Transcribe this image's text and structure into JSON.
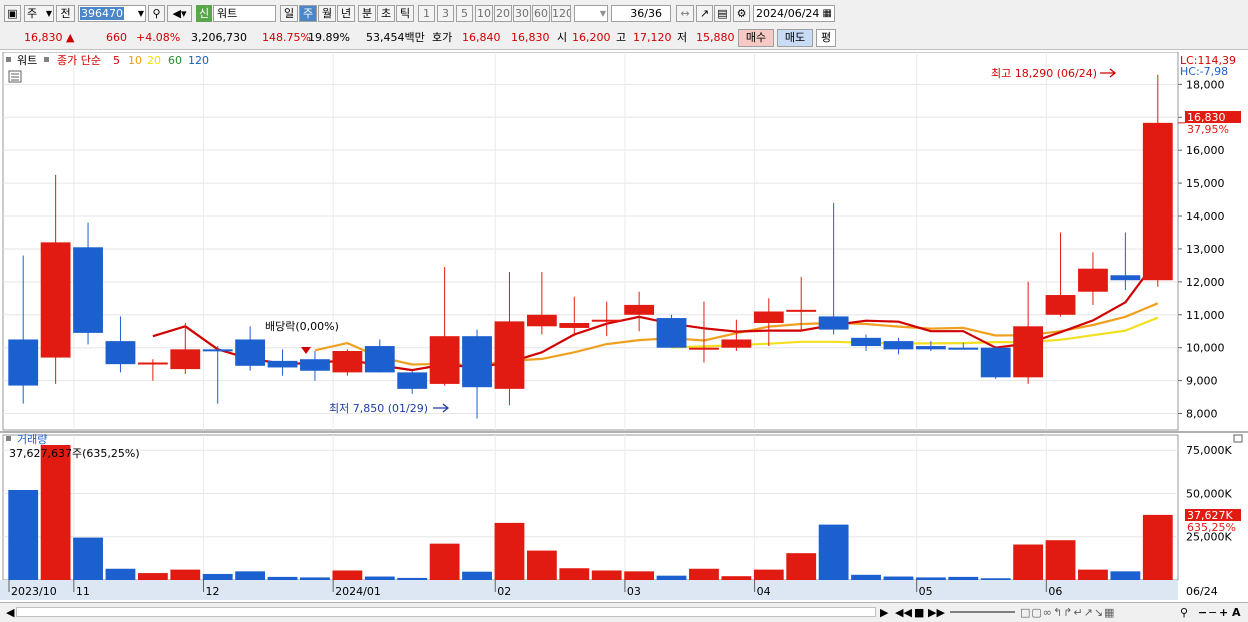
{
  "toolbar": {
    "period_selector": "주",
    "prev_label": "전",
    "code": "396470",
    "market_badge": "신",
    "stock_name": "워트",
    "period_tabs": [
      "일",
      "주",
      "월",
      "년",
      "분",
      "초",
      "틱"
    ],
    "active_period": "주",
    "intervals": [
      "1",
      "3",
      "5",
      "10",
      "20",
      "30",
      "60",
      "120"
    ],
    "count": "36/36",
    "date": "2024/06/24"
  },
  "quote": {
    "price": "16,830",
    "change_arrow": "▲",
    "change": "660",
    "change_pct": "+4.08%",
    "volume": "3,206,730",
    "volume_ratio": "148.75%",
    "turnover": "19.89%",
    "amount": "53,454백만",
    "hoga_label": "호가",
    "ask": "16,840",
    "bid": "16,830",
    "open_label": "시",
    "open": "16,200",
    "high_label": "고",
    "high": "17,120",
    "low_label": "저",
    "low": "15,880",
    "buy_label": "매수",
    "sell_label": "매도",
    "eval_label": "평"
  },
  "legend": {
    "name": "워트",
    "ma_label": "종가 단순",
    "periods": [
      "5",
      "10",
      "20",
      "60",
      "120"
    ],
    "period_colors": [
      "#d00000",
      "#e8a000",
      "#f0e000",
      "#2a8a2a",
      "#1060c0"
    ],
    "volume_title": "거래량",
    "volume_value": "37,627,637주(635,25%)"
  },
  "annotations": {
    "lc": "LC:114,39",
    "hc": "HC:-7,98",
    "max": "최고 18,290 (06/24)",
    "min": "최저 7,850 (01/29)",
    "dividend": "배당락(0,00%)",
    "price_tag": "16,830",
    "price_pct": "37,95%",
    "vol_tag": "37,627K",
    "vol_pct": "635,25%",
    "last_date": "06/24"
  },
  "colors": {
    "up": "#e21b12",
    "down": "#1c5fcf",
    "ma5": "#d00000",
    "ma10": "#f0a020",
    "ma20": "#f2e020"
  },
  "chart_data": {
    "type": "candlestick",
    "x_labels": [
      "2023/10",
      "11",
      "12",
      "2024/01",
      "02",
      "03",
      "04",
      "05",
      "06"
    ],
    "ylim": [
      7500,
      18800
    ],
    "yticks": [
      8000,
      9000,
      10000,
      11000,
      12000,
      13000,
      14000,
      15000,
      16000,
      17000,
      18000
    ],
    "vol_ticks": [
      25000,
      50000,
      75000
    ],
    "vol_tick_labels": [
      "25,000K",
      "50,000K",
      "75,000K"
    ],
    "vol_max": 78000,
    "candles": [
      {
        "o": 10250,
        "h": 12800,
        "l": 8300,
        "c": 8850,
        "v": 52000
      },
      {
        "o": 9700,
        "h": 15250,
        "l": 8900,
        "c": 13200,
        "v": 78000
      },
      {
        "o": 13050,
        "h": 13800,
        "l": 10100,
        "c": 10450,
        "v": 24500
      },
      {
        "o": 10200,
        "h": 10950,
        "l": 9250,
        "c": 9500,
        "v": 6500
      },
      {
        "o": 9500,
        "h": 9650,
        "l": 9000,
        "c": 9550,
        "v": 4000
      },
      {
        "o": 9350,
        "h": 10750,
        "l": 9200,
        "c": 9950,
        "v": 6000
      },
      {
        "o": 9950,
        "h": 10050,
        "l": 8300,
        "c": 9900,
        "v": 3500
      },
      {
        "o": 10250,
        "h": 10650,
        "l": 9300,
        "c": 9450,
        "v": 5000
      },
      {
        "o": 9600,
        "h": 9950,
        "l": 9150,
        "c": 9400,
        "v": 1800
      },
      {
        "o": 9650,
        "h": 9900,
        "l": 9000,
        "c": 9300,
        "v": 1500
      },
      {
        "o": 9250,
        "h": 9950,
        "l": 9150,
        "c": 9900,
        "v": 5500
      },
      {
        "o": 10050,
        "h": 10250,
        "l": 9250,
        "c": 9250,
        "v": 2000
      },
      {
        "o": 9250,
        "h": 9300,
        "l": 8600,
        "c": 8750,
        "v": 1200
      },
      {
        "o": 8900,
        "h": 12450,
        "l": 8850,
        "c": 10350,
        "v": 21000
      },
      {
        "o": 10350,
        "h": 10550,
        "l": 7850,
        "c": 8800,
        "v": 4800
      },
      {
        "o": 8750,
        "h": 12300,
        "l": 8250,
        "c": 10800,
        "v": 33000
      },
      {
        "o": 10650,
        "h": 12300,
        "l": 10400,
        "c": 11000,
        "v": 17000
      },
      {
        "o": 10600,
        "h": 11550,
        "l": 10350,
        "c": 10750,
        "v": 6800
      },
      {
        "o": 10800,
        "h": 11400,
        "l": 10350,
        "c": 10850,
        "v": 5500
      },
      {
        "o": 11000,
        "h": 11700,
        "l": 10500,
        "c": 11300,
        "v": 5000
      },
      {
        "o": 10900,
        "h": 11000,
        "l": 10000,
        "c": 10000,
        "v": 2500
      },
      {
        "o": 10000,
        "h": 11400,
        "l": 9550,
        "c": 10000,
        "v": 6500
      },
      {
        "o": 10000,
        "h": 10850,
        "l": 9900,
        "c": 10250,
        "v": 2200
      },
      {
        "o": 10750,
        "h": 11500,
        "l": 10050,
        "c": 11100,
        "v": 6000
      },
      {
        "o": 11100,
        "h": 12150,
        "l": 10500,
        "c": 11150,
        "v": 15500
      },
      {
        "o": 10950,
        "h": 14400,
        "l": 10400,
        "c": 10550,
        "v": 32000
      },
      {
        "o": 10300,
        "h": 10400,
        "l": 9900,
        "c": 10050,
        "v": 3000
      },
      {
        "o": 10200,
        "h": 10300,
        "l": 9800,
        "c": 9950,
        "v": 2000
      },
      {
        "o": 10050,
        "h": 10200,
        "l": 9900,
        "c": 9950,
        "v": 1500
      },
      {
        "o": 10000,
        "h": 10150,
        "l": 9950,
        "c": 9950,
        "v": 1800
      },
      {
        "o": 10000,
        "h": 10050,
        "l": 9050,
        "c": 9100,
        "v": 1000
      },
      {
        "o": 9100,
        "h": 12000,
        "l": 8900,
        "c": 10650,
        "v": 20500
      },
      {
        "o": 11000,
        "h": 13500,
        "l": 10950,
        "c": 11600,
        "v": 23000
      },
      {
        "o": 11700,
        "h": 12900,
        "l": 11300,
        "c": 12400,
        "v": 6000
      },
      {
        "o": 12200,
        "h": 13500,
        "l": 11750,
        "c": 12050,
        "v": 5000
      },
      {
        "o": 12050,
        "h": 18290,
        "l": 11850,
        "c": 16830,
        "v": 37627
      }
    ],
    "ma5": [
      null,
      null,
      null,
      null,
      10350,
      10650,
      9950,
      9660,
      9520,
      9520,
      9640,
      9460,
      9320,
      9490,
      9400,
      9560,
      9860,
      10400,
      10730,
      10940,
      10730,
      10590,
      10490,
      10520,
      10520,
      10690,
      10820,
      10790,
      10500,
      10500,
      10000,
      10130,
      10470,
      10830,
      11380,
      12700
    ],
    "ma10": [
      null,
      null,
      null,
      null,
      null,
      null,
      null,
      null,
      null,
      9920,
      10140,
      9710,
      9490,
      9510,
      9460,
      9600,
      9660,
      9860,
      10110,
      10230,
      10290,
      10220,
      10440,
      10640,
      10720,
      10750,
      10720,
      10640,
      10580,
      10600,
      10370,
      10380,
      10500,
      10690,
      10940,
      11350
    ],
    "ma20": [
      null,
      null,
      null,
      null,
      null,
      null,
      null,
      null,
      null,
      null,
      null,
      null,
      null,
      null,
      null,
      null,
      null,
      null,
      null,
      null,
      10010,
      10040,
      10080,
      10120,
      10180,
      10180,
      10150,
      10130,
      10130,
      10140,
      10170,
      10170,
      10240,
      10380,
      10520,
      10910
    ]
  }
}
